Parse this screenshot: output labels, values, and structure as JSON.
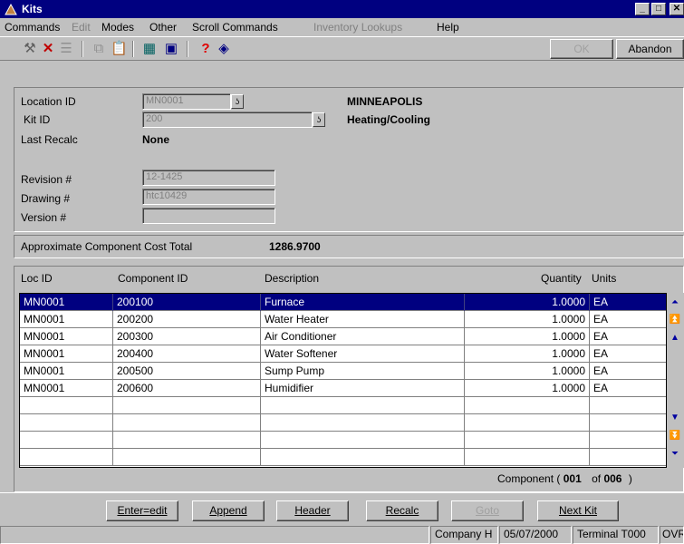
{
  "window": {
    "title": "Kits",
    "min_label": "_",
    "max_label": "□",
    "close_label": "✕"
  },
  "menu": {
    "commands": "Commands",
    "edit": "Edit",
    "modes": "Modes",
    "other": "Other",
    "scroll_commands": "Scroll Commands",
    "inventory_lookups": "Inventory Lookups",
    "help": "Help"
  },
  "toolbar": {
    "ok_label": "OK",
    "abandon_label": "Abandon"
  },
  "header": {
    "location_id_label": "Location ID",
    "location_id_value": "MN0001",
    "location_name": "MINNEAPOLIS",
    "kit_id_label": "Kit ID",
    "kit_id_value": "200",
    "kit_name": "Heating/Cooling",
    "last_recalc_label": "Last Recalc",
    "last_recalc_value": "None",
    "revision_label": "Revision #",
    "revision_value": "12-1425",
    "drawing_label": "Drawing #",
    "drawing_value": "htc10429",
    "version_label": "Version #",
    "version_value": "",
    "cost_label": "Approximate Component Cost Total",
    "cost_value": "1286.9700"
  },
  "grid": {
    "columns": {
      "loc": "Loc ID",
      "comp": "Component ID",
      "desc": "Description",
      "qty": "Quantity",
      "units": "Units"
    },
    "rows": [
      {
        "loc": "MN0001",
        "comp": "200100",
        "desc": "Furnace",
        "qty": "1.0000",
        "units": "EA"
      },
      {
        "loc": "MN0001",
        "comp": "200200",
        "desc": "Water Heater",
        "qty": "1.0000",
        "units": "EA"
      },
      {
        "loc": "MN0001",
        "comp": "200300",
        "desc": "Air Conditioner",
        "qty": "1.0000",
        "units": "EA"
      },
      {
        "loc": "MN0001",
        "comp": "200400",
        "desc": "Water Softener",
        "qty": "1.0000",
        "units": "EA"
      },
      {
        "loc": "MN0001",
        "comp": "200500",
        "desc": "Sump Pump",
        "qty": "1.0000",
        "units": "EA"
      },
      {
        "loc": "MN0001",
        "comp": "200600",
        "desc": "Humidifier",
        "qty": "1.0000",
        "units": "EA"
      },
      {
        "loc": "",
        "comp": "",
        "desc": "",
        "qty": "",
        "units": ""
      },
      {
        "loc": "",
        "comp": "",
        "desc": "",
        "qty": "",
        "units": ""
      },
      {
        "loc": "",
        "comp": "",
        "desc": "",
        "qty": "",
        "units": ""
      },
      {
        "loc": "",
        "comp": "",
        "desc": "",
        "qty": "",
        "units": ""
      }
    ],
    "counter_label": "Component (",
    "counter_current": "001",
    "counter_of": "of",
    "counter_total": "006",
    "counter_close": ")"
  },
  "buttons": {
    "enter_edit": "Enter=edit",
    "append": "Append",
    "header": "Header",
    "recalc": "Recalc",
    "goto": "Goto",
    "next_kit": "Next Kit"
  },
  "status": {
    "company": "Company H",
    "date": "05/07/2000",
    "terminal": "Terminal T000",
    "mode": "OVR"
  },
  "colors": {
    "title_bar": "#000080",
    "selection": "#000080",
    "face": "#c0c0c0"
  }
}
